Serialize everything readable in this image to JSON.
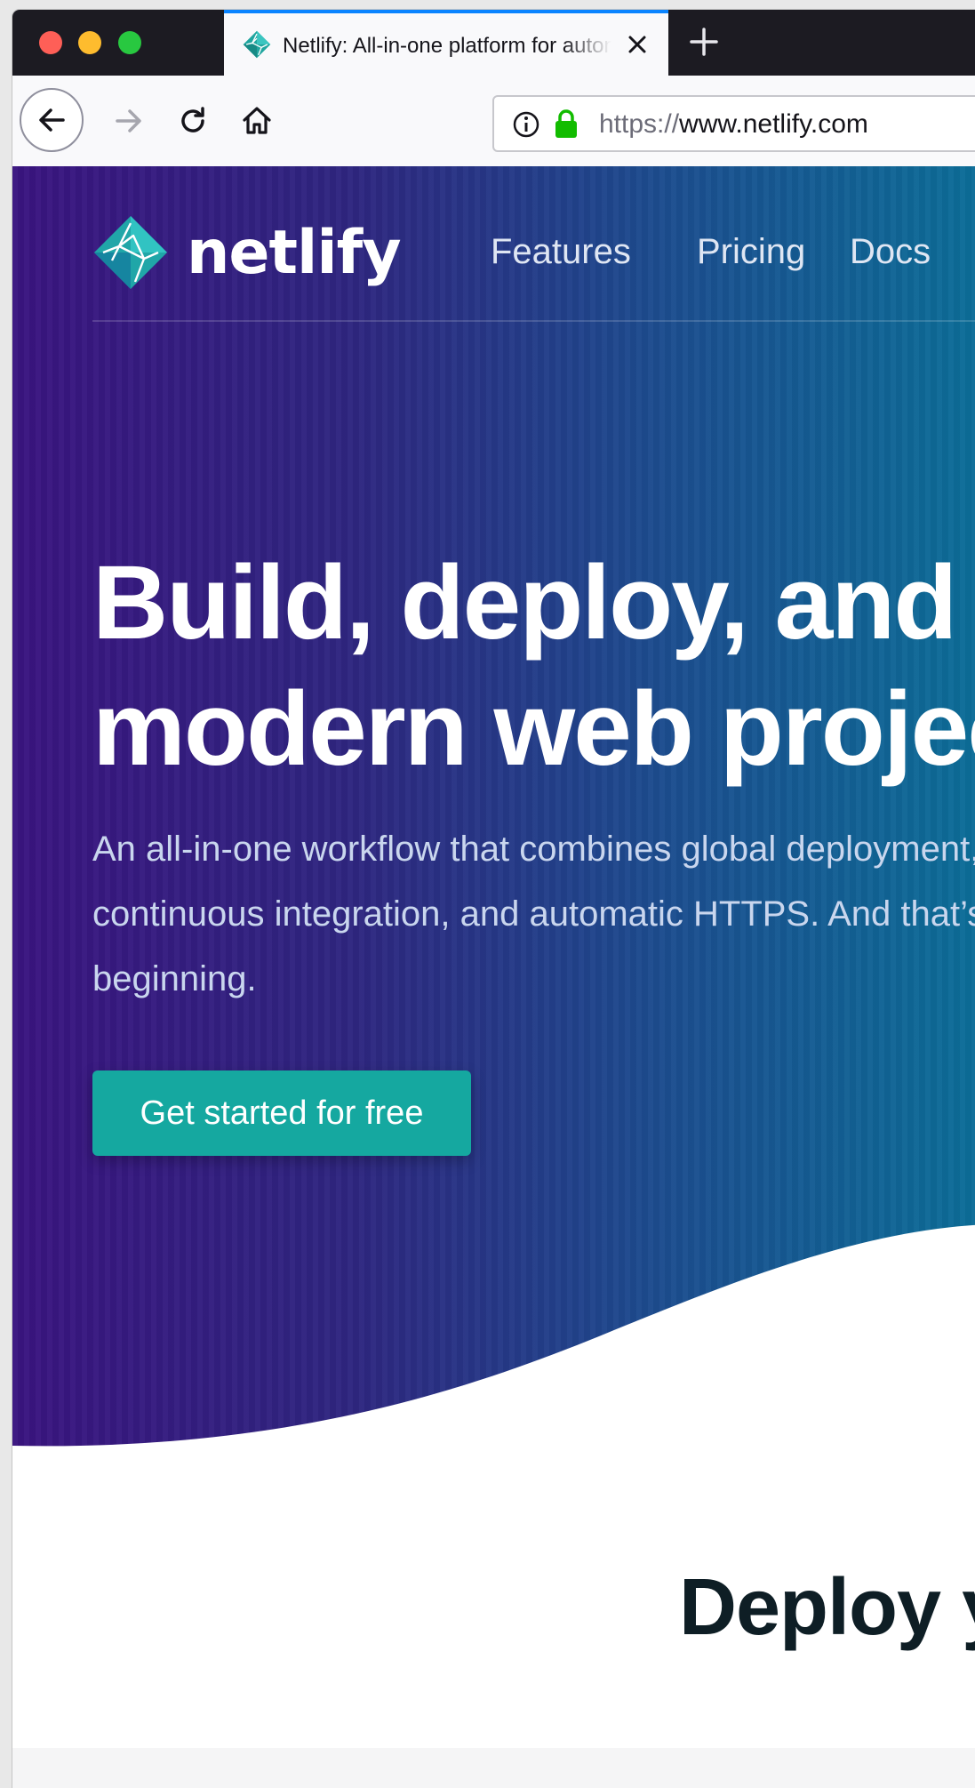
{
  "browser": {
    "tab_title": "Netlify: All-in-one platform for automating modern web projects",
    "url_scheme": "https://",
    "url_host": "www.netlify.com"
  },
  "nav": {
    "logo_text": "netlify",
    "links": [
      "Features",
      "Pricing",
      "Docs"
    ]
  },
  "hero": {
    "headline_line1": "Build, deploy, and manage",
    "headline_line2": "modern web projects",
    "subtext_line1": "An all-in-one workflow that combines global deployment,",
    "subtext_line2": "continuous integration, and automatic HTTPS. And that’s just the",
    "subtext_line3": "beginning.",
    "cta_label": "Get started for free"
  },
  "section": {
    "heading": "Deploy your"
  },
  "colors": {
    "brand_teal": "#15a8a0",
    "hero_start": "#3a1480",
    "hero_end": "#0b6f99",
    "tab_accent": "#0a84ff"
  }
}
